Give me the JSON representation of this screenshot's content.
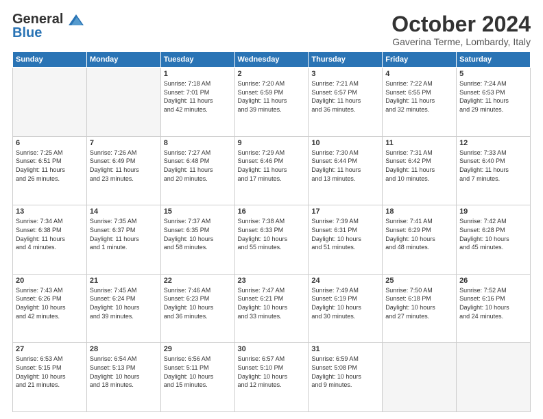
{
  "header": {
    "logo_line1": "General",
    "logo_line2": "Blue",
    "month": "October 2024",
    "location": "Gaverina Terme, Lombardy, Italy"
  },
  "weekdays": [
    "Sunday",
    "Monday",
    "Tuesday",
    "Wednesday",
    "Thursday",
    "Friday",
    "Saturday"
  ],
  "weeks": [
    [
      {
        "day": "",
        "info": ""
      },
      {
        "day": "",
        "info": ""
      },
      {
        "day": "1",
        "info": "Sunrise: 7:18 AM\nSunset: 7:01 PM\nDaylight: 11 hours\nand 42 minutes."
      },
      {
        "day": "2",
        "info": "Sunrise: 7:20 AM\nSunset: 6:59 PM\nDaylight: 11 hours\nand 39 minutes."
      },
      {
        "day": "3",
        "info": "Sunrise: 7:21 AM\nSunset: 6:57 PM\nDaylight: 11 hours\nand 36 minutes."
      },
      {
        "day": "4",
        "info": "Sunrise: 7:22 AM\nSunset: 6:55 PM\nDaylight: 11 hours\nand 32 minutes."
      },
      {
        "day": "5",
        "info": "Sunrise: 7:24 AM\nSunset: 6:53 PM\nDaylight: 11 hours\nand 29 minutes."
      }
    ],
    [
      {
        "day": "6",
        "info": "Sunrise: 7:25 AM\nSunset: 6:51 PM\nDaylight: 11 hours\nand 26 minutes."
      },
      {
        "day": "7",
        "info": "Sunrise: 7:26 AM\nSunset: 6:49 PM\nDaylight: 11 hours\nand 23 minutes."
      },
      {
        "day": "8",
        "info": "Sunrise: 7:27 AM\nSunset: 6:48 PM\nDaylight: 11 hours\nand 20 minutes."
      },
      {
        "day": "9",
        "info": "Sunrise: 7:29 AM\nSunset: 6:46 PM\nDaylight: 11 hours\nand 17 minutes."
      },
      {
        "day": "10",
        "info": "Sunrise: 7:30 AM\nSunset: 6:44 PM\nDaylight: 11 hours\nand 13 minutes."
      },
      {
        "day": "11",
        "info": "Sunrise: 7:31 AM\nSunset: 6:42 PM\nDaylight: 11 hours\nand 10 minutes."
      },
      {
        "day": "12",
        "info": "Sunrise: 7:33 AM\nSunset: 6:40 PM\nDaylight: 11 hours\nand 7 minutes."
      }
    ],
    [
      {
        "day": "13",
        "info": "Sunrise: 7:34 AM\nSunset: 6:38 PM\nDaylight: 11 hours\nand 4 minutes."
      },
      {
        "day": "14",
        "info": "Sunrise: 7:35 AM\nSunset: 6:37 PM\nDaylight: 11 hours\nand 1 minute."
      },
      {
        "day": "15",
        "info": "Sunrise: 7:37 AM\nSunset: 6:35 PM\nDaylight: 10 hours\nand 58 minutes."
      },
      {
        "day": "16",
        "info": "Sunrise: 7:38 AM\nSunset: 6:33 PM\nDaylight: 10 hours\nand 55 minutes."
      },
      {
        "day": "17",
        "info": "Sunrise: 7:39 AM\nSunset: 6:31 PM\nDaylight: 10 hours\nand 51 minutes."
      },
      {
        "day": "18",
        "info": "Sunrise: 7:41 AM\nSunset: 6:29 PM\nDaylight: 10 hours\nand 48 minutes."
      },
      {
        "day": "19",
        "info": "Sunrise: 7:42 AM\nSunset: 6:28 PM\nDaylight: 10 hours\nand 45 minutes."
      }
    ],
    [
      {
        "day": "20",
        "info": "Sunrise: 7:43 AM\nSunset: 6:26 PM\nDaylight: 10 hours\nand 42 minutes."
      },
      {
        "day": "21",
        "info": "Sunrise: 7:45 AM\nSunset: 6:24 PM\nDaylight: 10 hours\nand 39 minutes."
      },
      {
        "day": "22",
        "info": "Sunrise: 7:46 AM\nSunset: 6:23 PM\nDaylight: 10 hours\nand 36 minutes."
      },
      {
        "day": "23",
        "info": "Sunrise: 7:47 AM\nSunset: 6:21 PM\nDaylight: 10 hours\nand 33 minutes."
      },
      {
        "day": "24",
        "info": "Sunrise: 7:49 AM\nSunset: 6:19 PM\nDaylight: 10 hours\nand 30 minutes."
      },
      {
        "day": "25",
        "info": "Sunrise: 7:50 AM\nSunset: 6:18 PM\nDaylight: 10 hours\nand 27 minutes."
      },
      {
        "day": "26",
        "info": "Sunrise: 7:52 AM\nSunset: 6:16 PM\nDaylight: 10 hours\nand 24 minutes."
      }
    ],
    [
      {
        "day": "27",
        "info": "Sunrise: 6:53 AM\nSunset: 5:15 PM\nDaylight: 10 hours\nand 21 minutes."
      },
      {
        "day": "28",
        "info": "Sunrise: 6:54 AM\nSunset: 5:13 PM\nDaylight: 10 hours\nand 18 minutes."
      },
      {
        "day": "29",
        "info": "Sunrise: 6:56 AM\nSunset: 5:11 PM\nDaylight: 10 hours\nand 15 minutes."
      },
      {
        "day": "30",
        "info": "Sunrise: 6:57 AM\nSunset: 5:10 PM\nDaylight: 10 hours\nand 12 minutes."
      },
      {
        "day": "31",
        "info": "Sunrise: 6:59 AM\nSunset: 5:08 PM\nDaylight: 10 hours\nand 9 minutes."
      },
      {
        "day": "",
        "info": ""
      },
      {
        "day": "",
        "info": ""
      }
    ]
  ]
}
